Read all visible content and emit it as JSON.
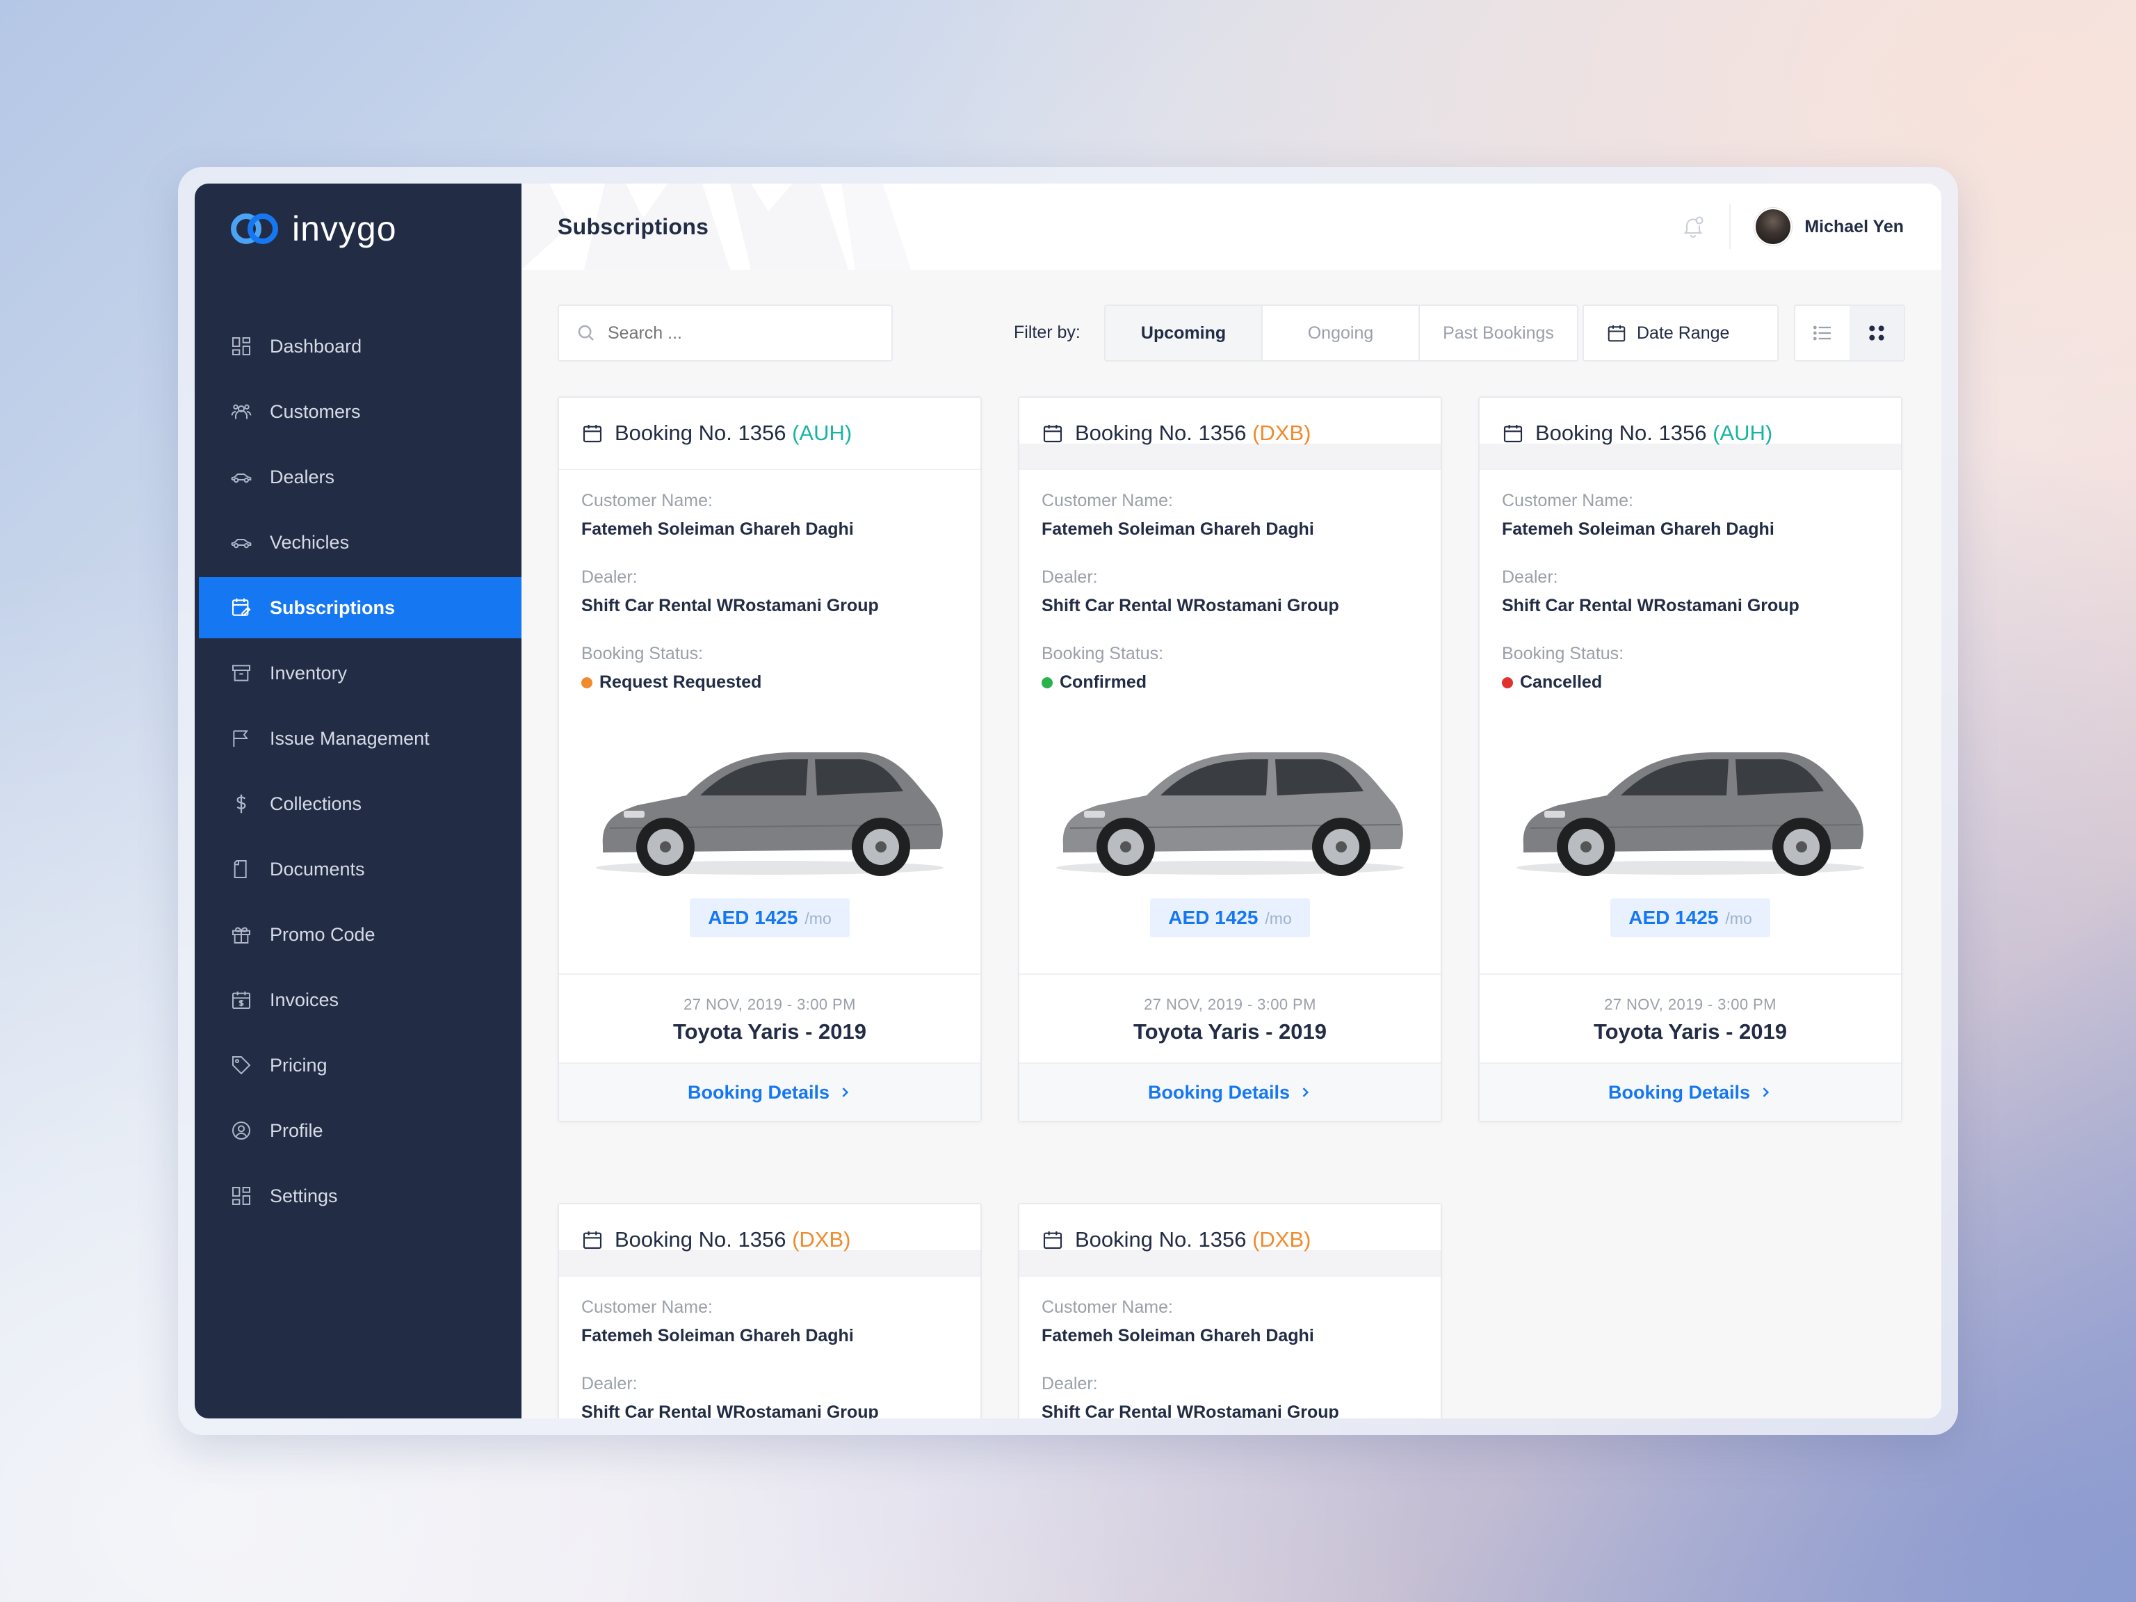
{
  "brand": {
    "name": "invygo"
  },
  "sidebar": {
    "items": [
      {
        "label": "Dashboard",
        "icon": "dashboard-icon"
      },
      {
        "label": "Customers",
        "icon": "customers-icon"
      },
      {
        "label": "Dealers",
        "icon": "car-icon"
      },
      {
        "label": "Vechicles",
        "icon": "car-icon"
      },
      {
        "label": "Subscriptions",
        "icon": "subscriptions-icon",
        "active": true
      },
      {
        "label": "Inventory",
        "icon": "archive-icon"
      },
      {
        "label": "Issue Management",
        "icon": "flag-icon"
      },
      {
        "label": "Collections",
        "icon": "dollar-icon"
      },
      {
        "label": "Documents",
        "icon": "document-icon"
      },
      {
        "label": "Promo Code",
        "icon": "gift-icon"
      },
      {
        "label": "Invoices",
        "icon": "invoice-calendar-icon"
      },
      {
        "label": "Pricing",
        "icon": "tag-icon"
      },
      {
        "label": "Profile",
        "icon": "profile-icon"
      },
      {
        "label": "Settings",
        "icon": "settings-grid-icon"
      }
    ]
  },
  "header": {
    "title": "Subscriptions",
    "user_name": "Michael Yen"
  },
  "toolbar": {
    "search_placeholder": "Search ...",
    "filter_label": "Filter by:",
    "filters": [
      "Upcoming",
      "Ongoing",
      "Past Bookings"
    ],
    "active_filter": "Upcoming",
    "date_range_label": "Date Range",
    "view_mode": "grid"
  },
  "labels": {
    "customer_name": "Customer Name:",
    "dealer": "Dealer:",
    "booking_status": "Booking Status:",
    "per_month": "/mo",
    "details": "Booking Details"
  },
  "colors": {
    "accent": "#1677f2",
    "sidebar_bg": "#222c45",
    "auh": "#19b3a3",
    "dxb": "#f08a2c",
    "status_requested": "#f08a2c",
    "status_confirmed": "#2bb24c",
    "status_cancelled": "#e0322c"
  },
  "bookings": [
    {
      "title": "Booking No. 1356",
      "location": "(AUH)",
      "customer": "Fatemeh Soleiman Ghareh Daghi",
      "dealer": "Shift Car Rental WRostamani Group",
      "status": "Request Requested",
      "status_color": "#f08a2c",
      "price": "AED 1425",
      "date": "27 NOV, 2019 - 3:00 PM",
      "car": "Toyota Yaris - 2019"
    },
    {
      "title": "Booking No. 1356",
      "location": "(DXB)",
      "customer": "Fatemeh Soleiman Ghareh Daghi",
      "dealer": "Shift Car Rental WRostamani Group",
      "status": "Confirmed",
      "status_color": "#2bb24c",
      "price": "AED 1425",
      "date": "27 NOV, 2019 - 3:00 PM",
      "car": "Toyota Yaris - 2019"
    },
    {
      "title": "Booking No. 1356",
      "location": "(AUH)",
      "customer": "Fatemeh Soleiman Ghareh Daghi",
      "dealer": "Shift Car Rental WRostamani Group",
      "status": "Cancelled",
      "status_color": "#e0322c",
      "price": "AED 1425",
      "date": "27 NOV, 2019 - 3:00 PM",
      "car": "Toyota Yaris - 2019"
    },
    {
      "title": "Booking No. 1356",
      "location": "(DXB)",
      "customer": "Fatemeh Soleiman Ghareh Daghi",
      "dealer": "Shift Car Rental WRostamani Group"
    },
    {
      "title": "Booking No. 1356",
      "location": "(DXB)",
      "customer": "Fatemeh Soleiman Ghareh Daghi",
      "dealer": "Shift Car Rental WRostamani Group"
    }
  ]
}
